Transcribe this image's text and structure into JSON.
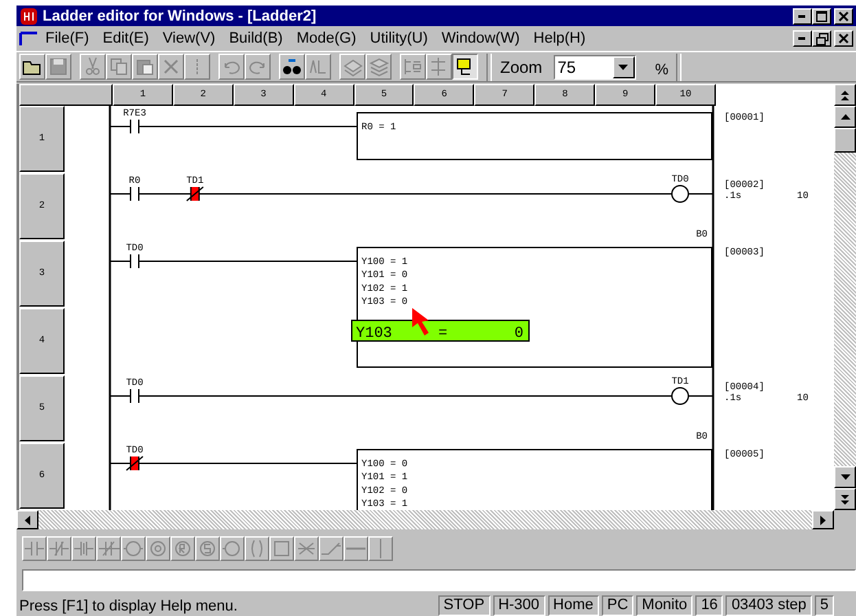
{
  "window": {
    "title": "Ladder editor for Windows - [Ladder2]"
  },
  "menu": [
    "File(F)",
    "Edit(E)",
    "View(V)",
    "Build(B)",
    "Mode(G)",
    "Utility(U)",
    "Window(W)",
    "Help(H)"
  ],
  "toolbar": {
    "buttons": [
      {
        "disabled": false,
        "pressed": false
      },
      {
        "disabled": true,
        "pressed": false
      },
      {
        "disabled": true,
        "pressed": false
      },
      {
        "disabled": true,
        "pressed": false
      },
      {
        "disabled": true,
        "pressed": false
      },
      {
        "disabled": true,
        "pressed": false
      },
      {
        "disabled": true,
        "pressed": false
      },
      {
        "disabled": true,
        "pressed": false
      },
      {
        "disabled": true,
        "pressed": false
      },
      {
        "disabled": false,
        "pressed": false
      },
      {
        "disabled": true,
        "pressed": false
      },
      {
        "disabled": true,
        "pressed": false
      },
      {
        "disabled": true,
        "pressed": false
      },
      {
        "disabled": true,
        "pressed": false
      },
      {
        "disabled": true,
        "pressed": false
      },
      {
        "disabled": false,
        "pressed": true
      }
    ],
    "zoom": {
      "label": "Zoom",
      "value": "75",
      "unit": "%"
    }
  },
  "ladder": {
    "column_headers": [
      "1",
      "2",
      "3",
      "4",
      "5",
      "6",
      "7",
      "8",
      "9",
      "10"
    ],
    "row_headers": [
      "1",
      "2",
      "3",
      "4",
      "5",
      "6"
    ],
    "rungs": [
      {
        "step": "[00001]",
        "contacts": [
          {
            "label": "R7E3",
            "kind": "no",
            "on": false
          }
        ],
        "output": {
          "kind": "box",
          "lines": [
            "R0 = 1"
          ]
        }
      },
      {
        "step": "[00002]",
        "contacts": [
          {
            "label": "R0",
            "kind": "no",
            "on": false
          },
          {
            "label": "TD1",
            "kind": "nc",
            "on": true
          }
        ],
        "output": {
          "kind": "coil",
          "label": "TD0",
          "params": [
            ".1s",
            "10"
          ]
        }
      },
      {
        "step": "[00003]",
        "box_label": "B0",
        "contacts": [
          {
            "label": "TD0",
            "kind": "no",
            "on": false
          }
        ],
        "output": {
          "kind": "box",
          "lines": [
            "Y100 = 1",
            "Y101 = 0",
            "Y102 = 1",
            "Y103 = 0"
          ]
        }
      },
      {
        "step": "[00004]",
        "contacts": [
          {
            "label": "TD0",
            "kind": "no",
            "on": false
          }
        ],
        "output": {
          "kind": "coil",
          "label": "TD1",
          "params": [
            ".1s",
            "10"
          ]
        }
      },
      {
        "step": "[00005]",
        "box_label": "B0",
        "contacts": [
          {
            "label": "TD0",
            "kind": "nc",
            "on": true
          }
        ],
        "output": {
          "kind": "box",
          "lines": [
            "Y100 = 0",
            "Y101 = 1",
            "Y102 = 0",
            "Y103 = 1"
          ]
        }
      }
    ],
    "monitor_tooltip": {
      "device": "Y103",
      "operator": "=",
      "value": "0"
    }
  },
  "status_bar": {
    "message": "Press [F1] to display Help menu.",
    "panes": [
      "STOP",
      "H-300",
      "Home",
      "PC",
      "Monito",
      "16",
      "03403 step",
      "5"
    ]
  }
}
